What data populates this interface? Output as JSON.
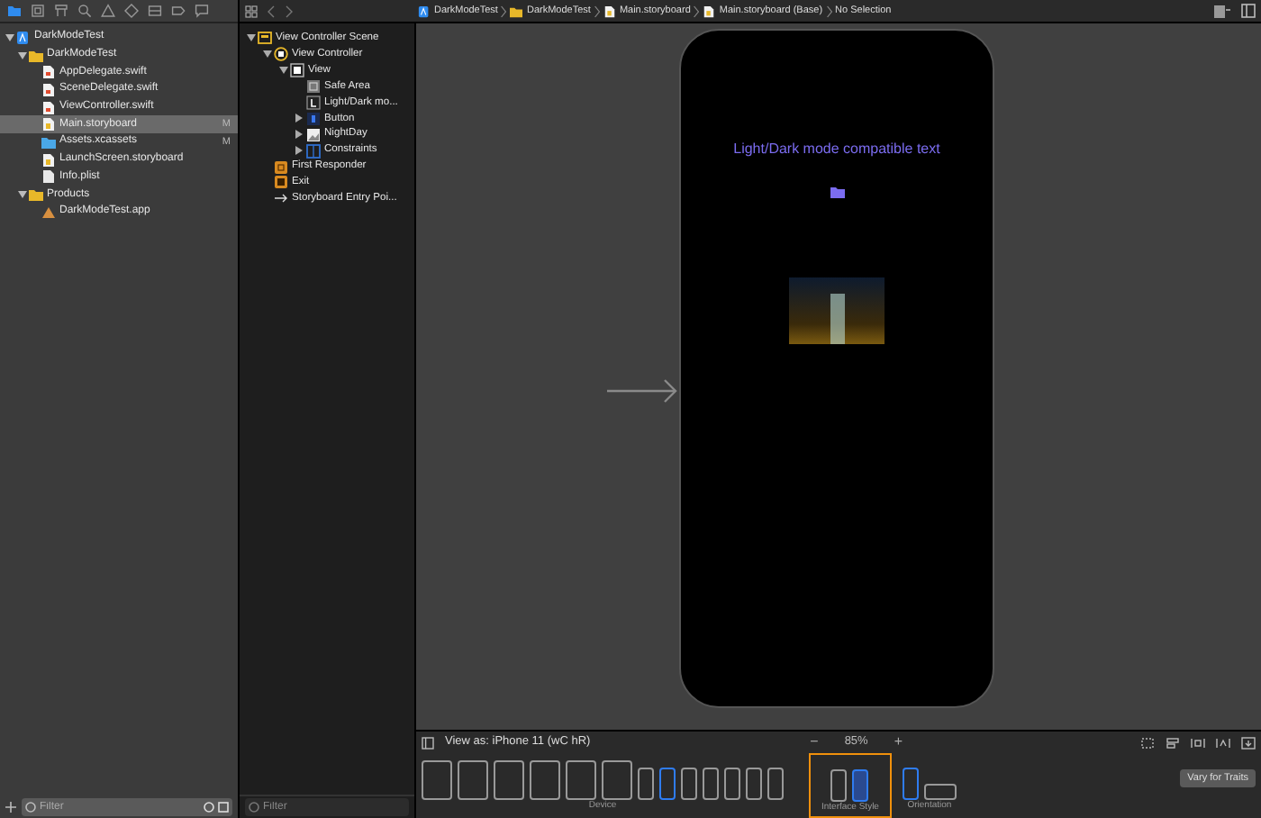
{
  "navigator": {
    "tree": [
      {
        "label": "DarkModeTest",
        "kind": "project",
        "expanded": true,
        "selected": false,
        "children": [
          {
            "label": "DarkModeTest",
            "kind": "folder",
            "expanded": true,
            "selected": false,
            "children": [
              {
                "label": "AppDelegate.swift",
                "kind": "swift",
                "selected": false
              },
              {
                "label": "SceneDelegate.swift",
                "kind": "swift",
                "selected": false
              },
              {
                "label": "ViewController.swift",
                "kind": "swift",
                "selected": false
              },
              {
                "label": "Main.storyboard",
                "kind": "storyboard",
                "selected": true,
                "badge": "M"
              },
              {
                "label": "Assets.xcassets",
                "kind": "assets",
                "selected": false,
                "badge": "M"
              },
              {
                "label": "LaunchScreen.storyboard",
                "kind": "storyboard",
                "selected": false
              },
              {
                "label": "Info.plist",
                "kind": "plist",
                "selected": false
              }
            ]
          },
          {
            "label": "Products",
            "kind": "folder",
            "expanded": true,
            "selected": false,
            "children": [
              {
                "label": "DarkModeTest.app",
                "kind": "app",
                "selected": false
              }
            ]
          }
        ]
      }
    ],
    "filter_placeholder": "Filter"
  },
  "breadcrumb": [
    {
      "label": "DarkModeTest",
      "kind": "project"
    },
    {
      "label": "DarkModeTest",
      "kind": "folder"
    },
    {
      "label": "Main.storyboard",
      "kind": "storyboard"
    },
    {
      "label": "Main.storyboard (Base)",
      "kind": "storyboard"
    },
    {
      "label": "No Selection",
      "kind": "none"
    }
  ],
  "outline": {
    "tree": [
      {
        "label": "View Controller Scene",
        "kind": "scene",
        "expanded": true,
        "children": [
          {
            "label": "View Controller",
            "kind": "vc",
            "expanded": true,
            "children": [
              {
                "label": "View",
                "kind": "view",
                "expanded": true,
                "children": [
                  {
                    "label": "Safe Area",
                    "kind": "safearea"
                  },
                  {
                    "label": "Light/Dark mo...",
                    "kind": "label"
                  },
                  {
                    "label": "Button",
                    "kind": "button",
                    "expanded": false
                  },
                  {
                    "label": "NightDay",
                    "kind": "image",
                    "expanded": false
                  },
                  {
                    "label": "Constraints",
                    "kind": "constraints",
                    "expanded": false
                  }
                ]
              }
            ]
          },
          {
            "label": "First Responder",
            "kind": "responder"
          },
          {
            "label": "Exit",
            "kind": "exit"
          },
          {
            "label": "Storyboard Entry Poi...",
            "kind": "entry"
          }
        ]
      }
    ],
    "filter_placeholder": "Filter"
  },
  "canvas": {
    "label": "Light/Dark mode compatible text"
  },
  "bottom_bar": {
    "view_as": "View as: iPhone 11 (wC hR)",
    "zoom_out": "−",
    "zoom": "85%",
    "zoom_in": "+",
    "devices": [
      {
        "kind": "ipad",
        "selected": false
      },
      {
        "kind": "ipad",
        "selected": false
      },
      {
        "kind": "ipad",
        "selected": false
      },
      {
        "kind": "ipad",
        "selected": false
      },
      {
        "kind": "ipad",
        "selected": false
      },
      {
        "kind": "ipad",
        "selected": false
      },
      {
        "kind": "iphone",
        "selected": false
      },
      {
        "kind": "iphone",
        "selected": true
      },
      {
        "kind": "iphone",
        "selected": false
      },
      {
        "kind": "iphone",
        "selected": false
      },
      {
        "kind": "iphone",
        "selected": false
      },
      {
        "kind": "iphone",
        "selected": false
      },
      {
        "kind": "iphone",
        "selected": false
      }
    ],
    "device_label": "Device",
    "interface_styles": [
      {
        "kind": "light",
        "selected": false
      },
      {
        "kind": "dark",
        "selected": true
      }
    ],
    "interface_style_label": "Interface Style",
    "orientations": [
      {
        "kind": "portrait",
        "selected": true
      },
      {
        "kind": "landscape",
        "selected": false
      }
    ],
    "orientation_label": "Orientation",
    "vary_button": "Vary for Traits"
  }
}
